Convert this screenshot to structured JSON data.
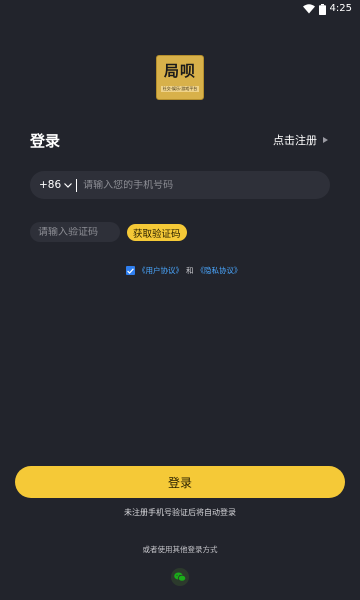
{
  "status_bar": {
    "time": "4:25"
  },
  "logo": {
    "main_text": "局呗",
    "sub_text": "社交·娱乐·游戏平台"
  },
  "login_title": "登录",
  "register_link": "点击注册",
  "phone": {
    "country_code": "+86",
    "placeholder": "请输入您的手机号码",
    "value": ""
  },
  "code": {
    "placeholder": "请输入验证码",
    "value": "",
    "get_code_label": "获取验证码"
  },
  "agreement": {
    "checked": true,
    "user_agreement": "《用户协议》",
    "and_text": "和",
    "privacy_agreement": "《隐私协议》"
  },
  "login_button": "登录",
  "auto_register_note": "未注册手机号验证后将自动登录",
  "other_login_text": "或者使用其他登录方式",
  "colors": {
    "background": "#22242c",
    "accent": "#f5c937",
    "field": "#2e3039",
    "link": "#4aa7ff",
    "wechat": "#1aad19"
  },
  "icons": [
    "wifi-icon",
    "battery-icon",
    "chevron-down-icon",
    "play-triangle-icon",
    "checkmark-icon",
    "wechat-icon"
  ]
}
